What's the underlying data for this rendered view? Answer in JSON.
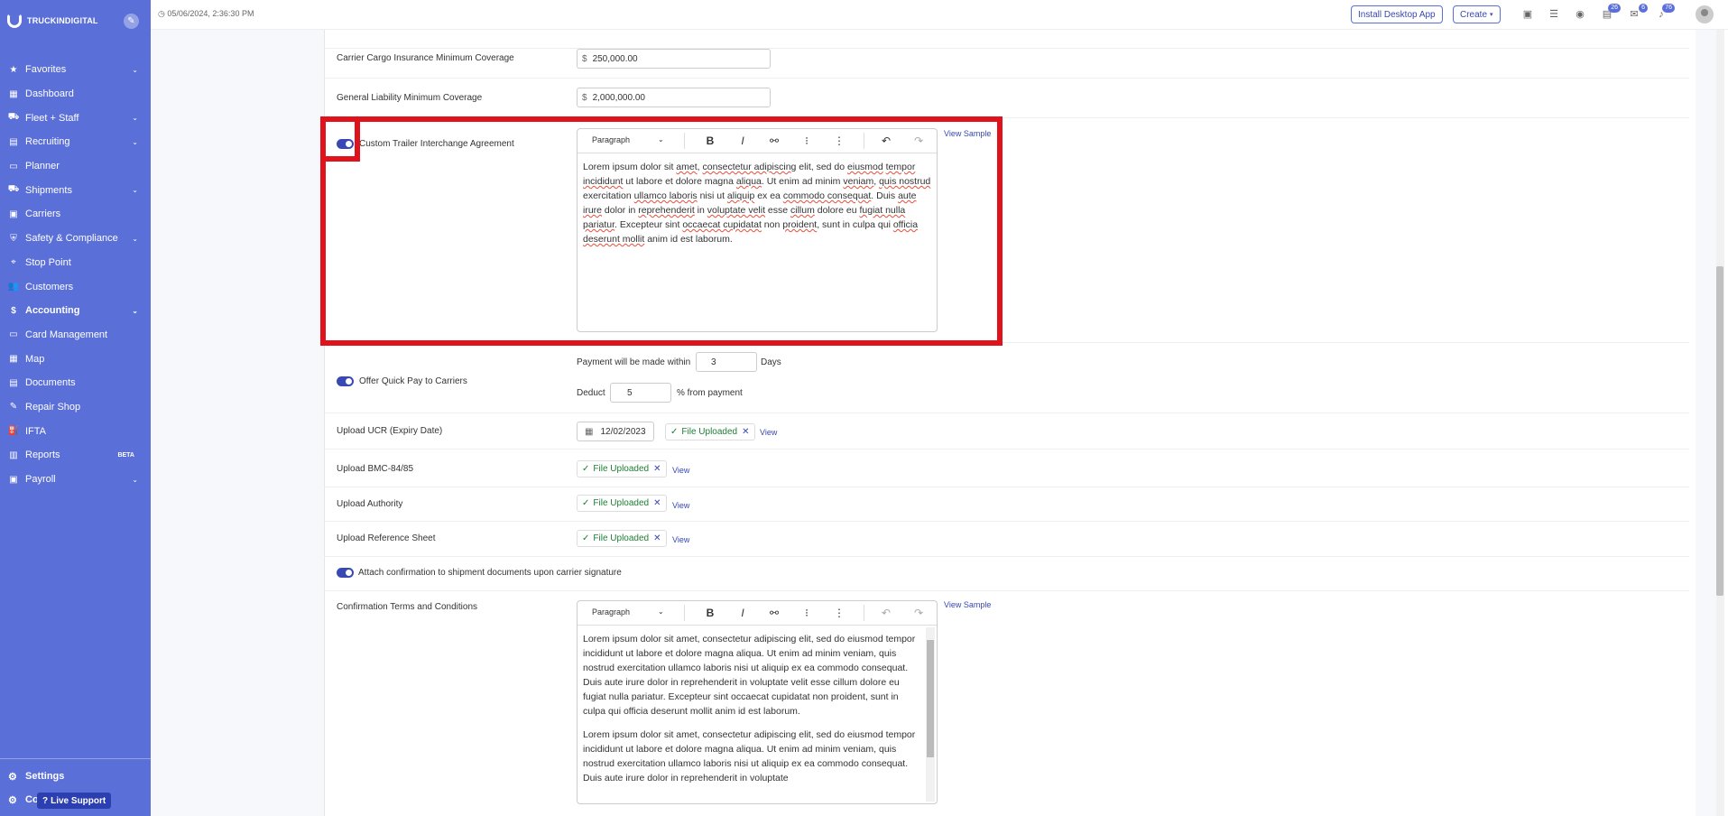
{
  "sidebar": {
    "brand": "TRUCKINDIGITAL",
    "items": [
      {
        "label": "Favorites",
        "icon": "star-icon",
        "chevron": true
      },
      {
        "label": "Dashboard",
        "icon": "dashboard-icon",
        "chevron": false
      },
      {
        "label": "Fleet + Staff",
        "icon": "fleet-icon",
        "chevron": true
      },
      {
        "label": "Recruiting",
        "icon": "recruiting-icon",
        "chevron": true
      },
      {
        "label": "Planner",
        "icon": "planner-icon",
        "chevron": false
      },
      {
        "label": "Shipments",
        "icon": "shipments-icon",
        "chevron": true
      },
      {
        "label": "Carriers",
        "icon": "carriers-icon",
        "chevron": false
      },
      {
        "label": "Safety & Compliance",
        "icon": "shield-icon",
        "chevron": true
      },
      {
        "label": "Stop Point",
        "icon": "pin-icon",
        "chevron": false
      },
      {
        "label": "Customers",
        "icon": "customers-icon",
        "chevron": false
      },
      {
        "label": "Accounting",
        "icon": "dollar-icon",
        "chevron": true
      },
      {
        "label": "Card Management",
        "icon": "card-icon",
        "chevron": false
      },
      {
        "label": "Map",
        "icon": "map-icon",
        "chevron": false
      },
      {
        "label": "Documents",
        "icon": "documents-icon",
        "chevron": false
      },
      {
        "label": "Repair Shop",
        "icon": "wrench-icon",
        "chevron": false
      },
      {
        "label": "IFTA",
        "icon": "fuel-icon",
        "chevron": false
      },
      {
        "label": "Reports",
        "icon": "reports-icon",
        "chevron": false,
        "badge": "BETA"
      },
      {
        "label": "Payroll",
        "icon": "payroll-icon",
        "chevron": true
      }
    ],
    "settings_label": "Settings",
    "collapse_label": "Co",
    "live_support_label": "Live Support"
  },
  "topbar": {
    "datetime": "05/06/2024, 2:36:30 PM",
    "install_label": "Install Desktop App",
    "create_label": "Create",
    "badges": {
      "tasks": "26",
      "messages": "6",
      "notifications": "76"
    }
  },
  "form": {
    "cargo_label": "Carrier Cargo Insurance Minimum Coverage",
    "cargo_currency": "$",
    "cargo_value": "250,000.00",
    "liability_label": "General Liability Minimum Coverage",
    "liability_currency": "$",
    "liability_value": "2,000,000.00",
    "trailer_label": "Custom Trailer Interchange Agreement",
    "view_sample": "View Sample",
    "paragraph": "Paragraph",
    "payment_within_label": "Payment will be made within",
    "payment_within_value": "3",
    "days_label": "Days",
    "deduct_label": "Deduct",
    "deduct_value": "5",
    "from_payment_label": "% from payment",
    "quickpay_label": "Offer Quick Pay to Carriers",
    "ucr_label": "Upload UCR (Expiry Date)",
    "ucr_date": "12/02/2023",
    "file_uploaded": "File Uploaded",
    "view_label": "View",
    "bmc_label": "Upload BMC-84/85",
    "authority_label": "Upload Authority",
    "reference_label": "Upload Reference Sheet",
    "attach_label": "Attach confirmation to shipment documents upon carrier signature",
    "terms_label": "Confirmation Terms and Conditions"
  },
  "colors": {
    "sidebar": "#5a6fd8",
    "accent": "#3848b5",
    "highlight": "#e0121b",
    "success": "#1e7e34"
  }
}
